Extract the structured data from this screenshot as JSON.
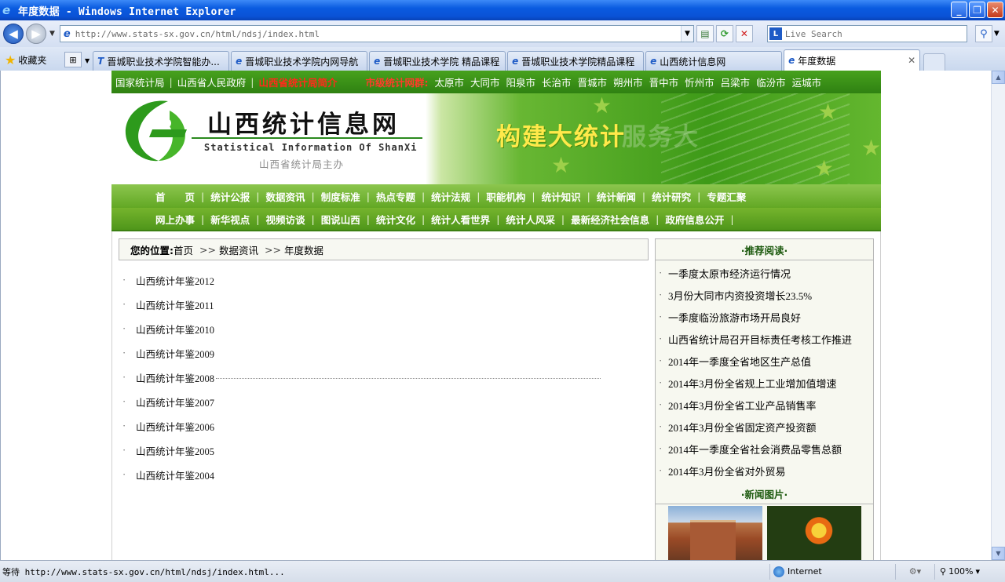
{
  "window": {
    "title": "年度数据 - Windows Internet Explorer",
    "minimize": "_",
    "restore": "❐",
    "close": "✕"
  },
  "addressbar": {
    "url": "http://www.stats-sx.gov.cn/html/ndsj/index.html",
    "search_placeholder": "Live Search"
  },
  "favorites": {
    "label": "收藏夹"
  },
  "tabs": [
    {
      "label": "晋城职业技术学院智能办..."
    },
    {
      "label": "晋城职业技术学院内网导航"
    },
    {
      "label": "晋城职业技术学院 精品课程"
    },
    {
      "label": "晋城职业技术学院精品课程"
    },
    {
      "label": "山西统计信息网"
    },
    {
      "label": "年度数据",
      "active": true
    }
  ],
  "site": {
    "top_links": [
      "国家统计局",
      "山西省人民政府",
      "山西省统计局简介"
    ],
    "city_title": "市级统计网群:",
    "cities": [
      "太原市",
      "大同市",
      "阳泉市",
      "长治市",
      "晋城市",
      "朔州市",
      "晋中市",
      "忻州市",
      "吕梁市",
      "临汾市",
      "运城市"
    ],
    "name_cn": "山西统计信息网",
    "name_en": "Statistical Information Of ShanXi",
    "sponsor": "山西省统计局主办",
    "slogan": "构建大统计",
    "slogan_ghost": "服务大",
    "nav_row1": [
      "首　　页",
      "统计公报",
      "数据资讯",
      "制度标准",
      "热点专题",
      "统计法规",
      "职能机构",
      "统计知识",
      "统计新闻",
      "统计研究",
      "专题汇聚"
    ],
    "nav_row2": [
      "网上办事",
      "新华视点",
      "视频访谈",
      "图说山西",
      "统计文化",
      "统计人看世界",
      "统计人风采",
      "最新经济社会信息",
      "政府信息公开"
    ],
    "breadcrumb": {
      "label": "您的位置:",
      "items": [
        "首页",
        "数据资讯",
        "年度数据"
      ],
      "sep": ">>"
    },
    "yearbooks": [
      "山西统计年鉴2012",
      "山西统计年鉴2011",
      "山西统计年鉴2010",
      "山西统计年鉴2009",
      "山西统计年鉴2008",
      "山西统计年鉴2007",
      "山西统计年鉴2006",
      "山西统计年鉴2005",
      "山西统计年鉴2004"
    ],
    "recommend_title": "·推荐阅读·",
    "recommend": [
      "一季度太原市经济运行情况",
      "3月份大同市内资投资增长23.5%",
      "一季度临汾旅游市场开局良好",
      "山西省统计局召开目标责任考核工作推进",
      "2014年一季度全省地区生产总值",
      "2014年3月份全省规上工业增加值增速",
      "2014年3月份全省工业产品销售率",
      "2014年3月份全省固定资产投资额",
      "2014年一季度全省社会消费品零售总额",
      "2014年3月份全省对外贸易"
    ],
    "photos_title": "·新闻图片·"
  },
  "status": {
    "text": "等待 http://www.stats-sx.gov.cn/html/ndsj/index.html...",
    "zone": "Internet",
    "zoom": "100%"
  },
  "colors": {
    "site_green": "#3e9a18",
    "intro_red": "#ff2a1a",
    "ie_blue": "#0a52d6"
  }
}
